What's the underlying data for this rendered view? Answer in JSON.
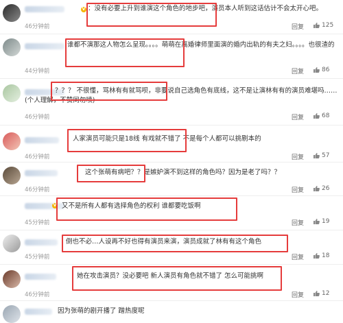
{
  "colors": {
    "highlight_box": "#e53b3b",
    "time_text": "#9a9a9a",
    "action_text": "#666666",
    "body_text": "#333333",
    "vip_badge": "#f5b400"
  },
  "icons": {
    "like": "thumbs-up-icon",
    "vip": "vip-badge-icon"
  },
  "comments": [
    {
      "text": "：没有必要上升到谁演这个角色的地步吧，演员本人听到这话估计不会太开心吧。",
      "time": "46分钟前",
      "reply": "回复",
      "likes": "125"
    },
    {
      "text": "谁都不演那这人物怎么呈现。。。。萌萌在离婚律师里面演的婚内出轨的有夫之妇。。。。也很渣的",
      "time": "44分钟前",
      "reply": "回复",
      "likes": "86"
    },
    {
      "text": "？？？ 不很懂，骂林有有就骂呗，非要说自己选角色有底线，这不是让演林有有的演员难堪吗……(个人理解，不赞同勿喷)",
      "time": "46分钟前",
      "reply": "回复",
      "likes": "68"
    },
    {
      "text": "人家演员可能只是18线 有戏就不错了 不是每个人都可以挑剔本的",
      "time": "46分钟前",
      "reply": "回复",
      "likes": "57"
    },
    {
      "text": "这个张萌有病吧？？是嫉妒演不到这样的角色吗？因为是老了吗？？",
      "time": "46分钟前",
      "reply": "回复",
      "likes": "26"
    },
    {
      "text": "又不是所有人都有选择角色的权利 谁都要吃饭啊",
      "time": "45分钟前",
      "reply": "回复",
      "likes": "19"
    },
    {
      "text": "倒也不必…人设再不好也得有演员来演，演员成就了林有有这个角色",
      "time": "45分钟前",
      "reply": "回复",
      "likes": "18"
    },
    {
      "text": "她在攻击演员？没必要吧 新人演员有角色就不错了 怎么可能挑啊",
      "time": "46分钟前",
      "reply": "回复",
      "likes": "12"
    },
    {
      "text": "因为张萌的剧开播了 蹭热度呢",
      "time": "",
      "reply": "",
      "likes": ""
    }
  ]
}
